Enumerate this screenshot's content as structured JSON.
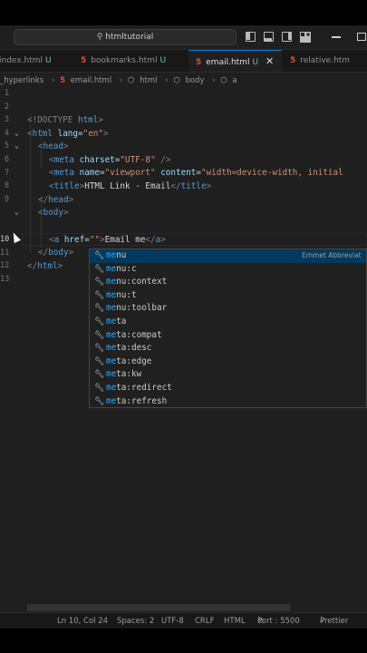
{
  "titlebar": {
    "search_text": "htmltutorial"
  },
  "tabs": [
    {
      "label": "index.html",
      "status": "U"
    },
    {
      "label": "bookmarks.html",
      "status": "U"
    },
    {
      "label": "email.html",
      "status": "U",
      "active": true
    },
    {
      "label": "relative.htm",
      "status": ""
    }
  ],
  "breadcrumb": [
    "_hyperlinks",
    "email.html",
    "html",
    "body",
    "a"
  ],
  "editor": {
    "line_numbers": [
      "1",
      "2",
      "3",
      "4",
      "5",
      "6",
      "7",
      "8",
      "9",
      "10",
      "11",
      "12",
      "13"
    ],
    "lines": {
      "l1": {
        "a": "<!DOCTYPE ",
        "b": "html",
        "c": ">"
      },
      "l2": {
        "open": "<",
        "tag": "html",
        "attr": " lang",
        "eq": "=",
        "val": "\"en\"",
        "close": ">"
      },
      "l3": {
        "open": "<",
        "tag": "head",
        "close": ">"
      },
      "l4": {
        "open": "<",
        "tag": "meta",
        "attr": " charset",
        "eq": "=",
        "val": "\"UTF-8\"",
        "close": " />"
      },
      "l5": {
        "open": "<",
        "tag": "meta",
        "attr1": " name",
        "eq1": "=",
        "val1": "\"viewport\"",
        "attr2": " content",
        "eq2": "=",
        "val2": "\"width=device-width, initial"
      },
      "l6": {
        "open": "<",
        "tag": "title",
        "close": ">",
        "text": "HTML Link - Email",
        "end_open": "</",
        "end_tag": "title",
        "end_close": ">"
      },
      "l7": {
        "open": "</",
        "tag": "head",
        "close": ">"
      },
      "l8": {
        "open": "<",
        "tag": "body",
        "close": ">"
      },
      "l10": {
        "open": "<",
        "tag": "a",
        "attr": " href",
        "eq": "=",
        "val": "\"\"",
        "close": ">",
        "text": "Email me",
        "end_open": "</",
        "end_tag": "a",
        "end_close": ">"
      },
      "l11": {
        "open": "</",
        "tag": "body",
        "close": ">"
      },
      "l12": {
        "open": "</",
        "tag": "html",
        "close": ">"
      }
    }
  },
  "suggestions": {
    "typed": "me",
    "items": [
      {
        "rest": "nu",
        "detail": "Emmet Abbreviat"
      },
      {
        "rest": "nu:c"
      },
      {
        "rest": "nu:context"
      },
      {
        "rest": "nu:t"
      },
      {
        "rest": "nu:toolbar"
      },
      {
        "rest": "ta"
      },
      {
        "rest": "ta:compat"
      },
      {
        "rest": "ta:desc"
      },
      {
        "rest": "ta:edge"
      },
      {
        "rest": "ta:kw"
      },
      {
        "rest": "ta:redirect"
      },
      {
        "rest": "ta:refresh"
      }
    ]
  },
  "statusbar": {
    "position": "Ln 10, Col 24",
    "spaces": "Spaces: 2",
    "encoding": "UTF-8",
    "eol": "CRLF",
    "language": "HTML",
    "port": "Port : 5500",
    "prettier": "Prettier"
  }
}
